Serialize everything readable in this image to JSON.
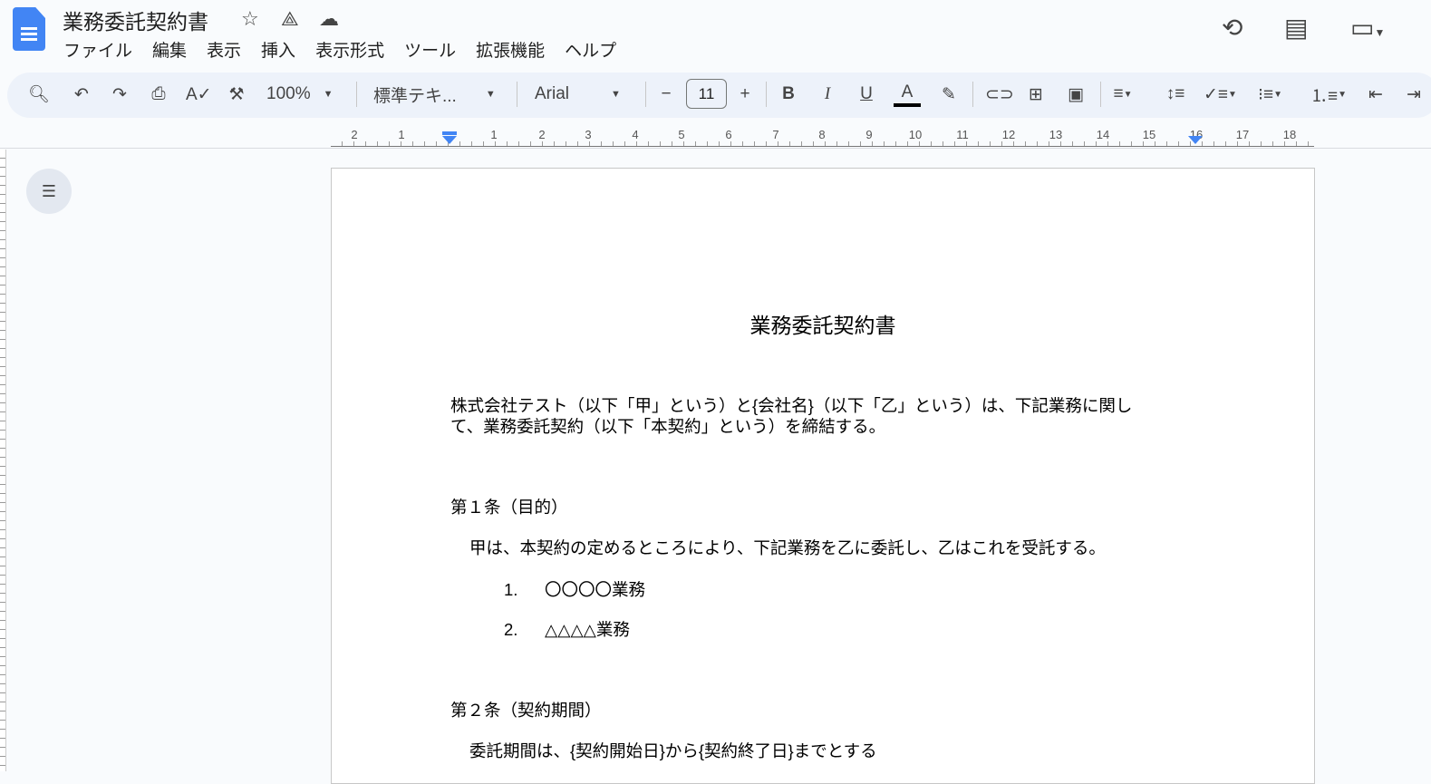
{
  "header": {
    "title": "業務委託契約書",
    "menu": [
      "ファイル",
      "編集",
      "表示",
      "挿入",
      "表示形式",
      "ツール",
      "拡張機能",
      "ヘルプ"
    ]
  },
  "toolbar": {
    "zoom": "100%",
    "style": "標準テキ...",
    "font": "Arial",
    "font_size": "11",
    "bold": "B",
    "italic": "I",
    "underline": "U",
    "text_color": "A"
  },
  "ruler": {
    "ticks": [
      "2",
      "1",
      "1",
      "2",
      "3",
      "4",
      "5",
      "6",
      "7",
      "8",
      "9",
      "10",
      "11",
      "12",
      "13",
      "14",
      "15",
      "16",
      "17",
      "18"
    ]
  },
  "document": {
    "title": "業務委託契約書",
    "intro_line1": "株式会社テスト（以下「甲」という）と{会社名}（以下「乙」という）は、下記業務に関し",
    "intro_line2": "て、業務委託契約（以下「本契約」という）を締結する。",
    "art1_heading": "第１条（目的）",
    "art1_body": "甲は、本契約の定めるところにより、下記業務を乙に委託し、乙はこれを受託する。",
    "list": [
      {
        "num": "1.",
        "text": "〇〇〇〇業務"
      },
      {
        "num": "2.",
        "text": "△△△△業務"
      }
    ],
    "art2_heading": "第２条（契約期間）",
    "art2_body": "委託期間は、{契約開始日}から{契約終了日}までとする"
  }
}
